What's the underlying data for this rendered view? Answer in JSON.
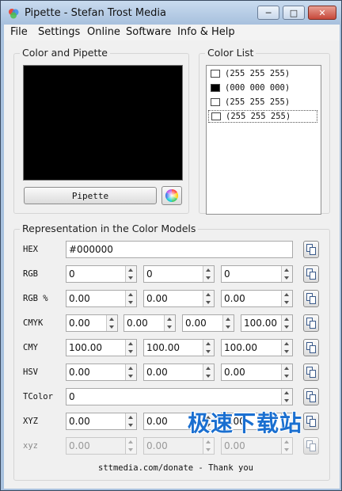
{
  "window": {
    "title": "Pipette - Stefan Trost Media"
  },
  "menu": [
    "File",
    "Settings",
    "Online",
    "Software",
    "Info & Help"
  ],
  "color_pipette": {
    "group_title": "Color and Pipette",
    "preview_color": "#000000",
    "pipette_label": "Pipette"
  },
  "color_list": {
    "group_title": "Color List",
    "items": [
      {
        "label": "(255 255 255)",
        "swatch": "#ffffff"
      },
      {
        "label": "(000 000 000)",
        "swatch": "#000000"
      },
      {
        "label": "(255 255 255)",
        "swatch": "#ffffff"
      },
      {
        "label": "(255 255 255)",
        "swatch": "#ffffff"
      }
    ],
    "selected_index": 3
  },
  "models": {
    "group_title": "Representation in the Color Models",
    "rows": [
      {
        "label": "HEX",
        "values": [
          "#000000"
        ]
      },
      {
        "label": "RGB",
        "values": [
          "0",
          "0",
          "0"
        ]
      },
      {
        "label": "RGB %",
        "values": [
          "0.00",
          "0.00",
          "0.00"
        ]
      },
      {
        "label": "CMYK",
        "values": [
          "0.00",
          "0.00",
          "0.00",
          "100.00"
        ]
      },
      {
        "label": "CMY",
        "values": [
          "100.00",
          "100.00",
          "100.00"
        ]
      },
      {
        "label": "HSV",
        "values": [
          "0.00",
          "0.00",
          "0.00"
        ]
      },
      {
        "label": "TColor",
        "values": [
          "0"
        ]
      },
      {
        "label": "XYZ",
        "values": [
          "0.00",
          "0.00",
          "0.00"
        ]
      },
      {
        "label": "xyz",
        "values": [
          "0.00",
          "0.00",
          "0.00"
        ]
      }
    ]
  },
  "footer": {
    "link_text": "sttmedia.com/donate - Thank you"
  },
  "watermark": {
    "text": "极速下载站"
  }
}
